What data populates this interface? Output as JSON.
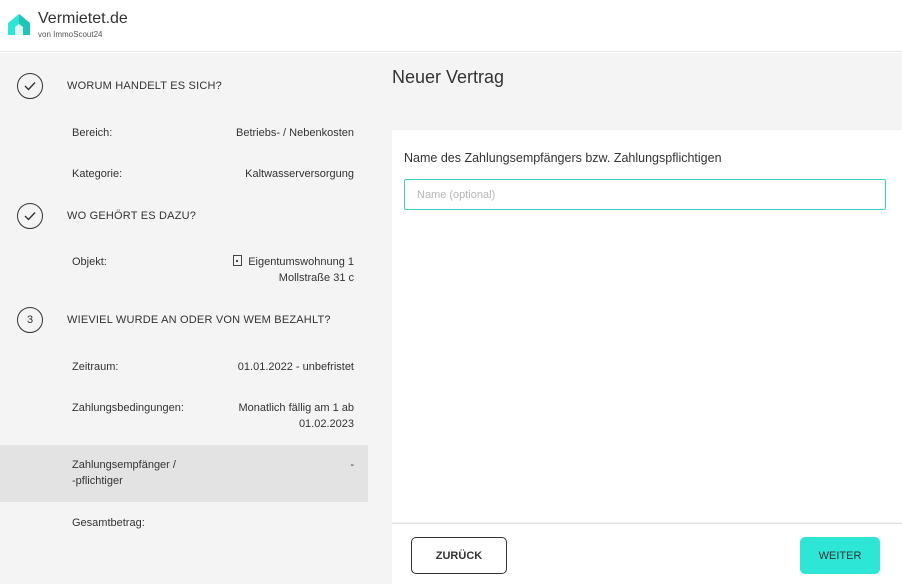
{
  "brand": {
    "name": "Vermietet.de",
    "subtitle": "von ImmoScout24"
  },
  "colors": {
    "accent": "#2ee6d6",
    "input_border": "#3ccfc6",
    "sidebar_bg": "#f4f4f4"
  },
  "sidebar": {
    "step1": {
      "title": "WORUM HANDELT ES SICH?",
      "rows": [
        {
          "label": "Bereich:",
          "value": "Betriebs- / Nebenkosten"
        },
        {
          "label": "Kategorie:",
          "value": "Kaltwasserversorgung"
        }
      ]
    },
    "step2": {
      "title": "WO GEHÖRT ES DAZU?",
      "rows": [
        {
          "label": "Objekt:",
          "value_line1": "Eigentumswohnung 1",
          "value_line2": "Mollstraße 31 c"
        }
      ]
    },
    "step3": {
      "number": "3",
      "title": "WIEVIEL WURDE AN ODER VON WEM BEZAHLT?",
      "rows": [
        {
          "label": "Zeitraum:",
          "value": "01.01.2022 - unbefristet"
        },
        {
          "label": "Zahlungsbedingungen:",
          "value_line1": "Monatlich fällig am 1 ab",
          "value_line2": "01.02.2023"
        },
        {
          "label_line1": "Zahlungsempfänger /",
          "label_line2": "-pflichtiger",
          "value": "-"
        },
        {
          "label": "Gesamtbetrag:"
        }
      ]
    }
  },
  "main": {
    "title": "Neuer Vertrag",
    "field_label": "Name des Zahlungsempfängers bzw. Zahlungspflichtigen",
    "field_placeholder": "Name (optional)",
    "field_value": ""
  },
  "footer": {
    "back_label": "ZURÜCK",
    "next_label": "WEITER"
  }
}
